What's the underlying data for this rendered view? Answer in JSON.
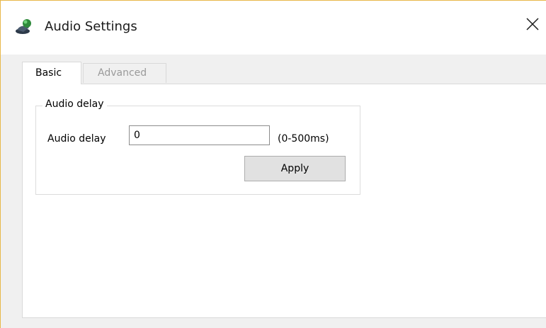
{
  "window": {
    "title": "Audio Settings",
    "icon": "satellite-dish-icon",
    "close_glyph": "✕"
  },
  "tabs": [
    {
      "label": "Basic",
      "active": true
    },
    {
      "label": "Advanced",
      "active": false
    }
  ],
  "audio_delay_group": {
    "legend": "Audio delay",
    "field_label": "Audio delay",
    "input_value": "0",
    "range_hint": "(0-500ms)",
    "apply_label": "Apply"
  },
  "colors": {
    "window_border": "#e8b84a",
    "inactive_tab_text": "#9a9a9a"
  }
}
